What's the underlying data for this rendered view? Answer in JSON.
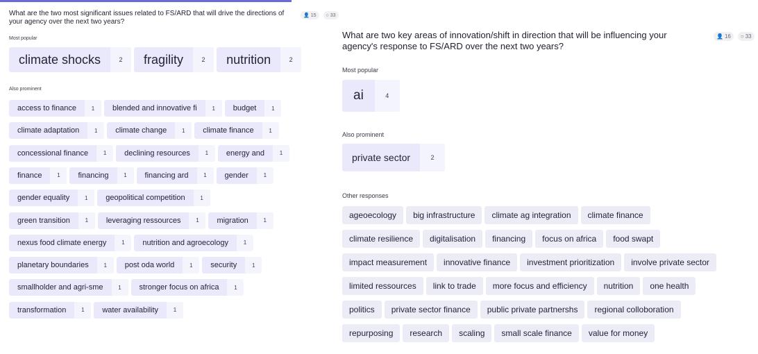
{
  "left": {
    "question": "What are the two most significant issues related to FS/ARD that will drive the directions of your agency over the next two years?",
    "participants": "15",
    "responses": "33",
    "popular_label": "Most popular",
    "popular": [
      {
        "text": "climate shocks",
        "count": "2"
      },
      {
        "text": "fragility",
        "count": "2"
      },
      {
        "text": "nutrition",
        "count": "2"
      }
    ],
    "prominent_label": "Also prominent",
    "rows": [
      [
        {
          "text": "access to finance",
          "count": "1"
        },
        {
          "text": "blended and innovative fi",
          "count": "1"
        },
        {
          "text": "budget",
          "count": "1"
        }
      ],
      [
        {
          "text": "climate adaptation",
          "count": "1"
        },
        {
          "text": "climate change",
          "count": "1"
        },
        {
          "text": "climate finance",
          "count": "1"
        }
      ],
      [
        {
          "text": "concessional finance",
          "count": "1"
        },
        {
          "text": "declining resources",
          "count": "1"
        },
        {
          "text": "energy and",
          "count": "1"
        }
      ],
      [
        {
          "text": "finance",
          "count": "1"
        },
        {
          "text": "financing",
          "count": "1"
        },
        {
          "text": "financing ard",
          "count": "1"
        },
        {
          "text": "gender",
          "count": "1"
        }
      ],
      [
        {
          "text": "gender equality",
          "count": "1"
        },
        {
          "text": "geopolitical competition",
          "count": "1"
        }
      ],
      [
        {
          "text": "green transition",
          "count": "1"
        },
        {
          "text": "leveraging ressources",
          "count": "1"
        },
        {
          "text": "migration",
          "count": "1"
        }
      ],
      [
        {
          "text": "nexus food climate energy",
          "count": "1"
        },
        {
          "text": "nutrition and agroecology",
          "count": "1"
        }
      ],
      [
        {
          "text": "planetary boundaries",
          "count": "1"
        },
        {
          "text": "post oda world",
          "count": "1"
        },
        {
          "text": "security",
          "count": "1"
        }
      ],
      [
        {
          "text": "smallholder and agri-sme",
          "count": "1"
        },
        {
          "text": "stronger focus on africa",
          "count": "1"
        }
      ],
      [
        {
          "text": "transformation",
          "count": "1"
        },
        {
          "text": "water availability",
          "count": "1"
        }
      ]
    ]
  },
  "right": {
    "question": "What are two key areas of innovation/shift in direction that will be influencing your agency's response to FS/ARD over the next two years?",
    "participants": "16",
    "responses": "33",
    "popular_label": "Most popular",
    "popular": [
      {
        "text": "ai",
        "count": "4"
      }
    ],
    "prominent_label": "Also prominent",
    "prominent": [
      {
        "text": "private sector",
        "count": "2"
      }
    ],
    "other_label": "Other responses",
    "other_rows": [
      [
        "ageoecology",
        "big infrastructure",
        "climate ag integration",
        "climate finance"
      ],
      [
        "climate resilience",
        "digitalisation",
        "financing",
        "focus on africa",
        "food swapt"
      ],
      [
        "impact measurement",
        "innovative finance",
        "investment prioritization",
        "involve private sector"
      ],
      [
        "limited ressources",
        "link to trade",
        "more focus and efficiency",
        "nutrition",
        "one health"
      ],
      [
        "politics",
        "private sector finance",
        "public private partnershs",
        "regional colloboration"
      ],
      [
        "repurposing",
        "research",
        "scaling",
        "small scale finance",
        "value for money"
      ]
    ]
  }
}
